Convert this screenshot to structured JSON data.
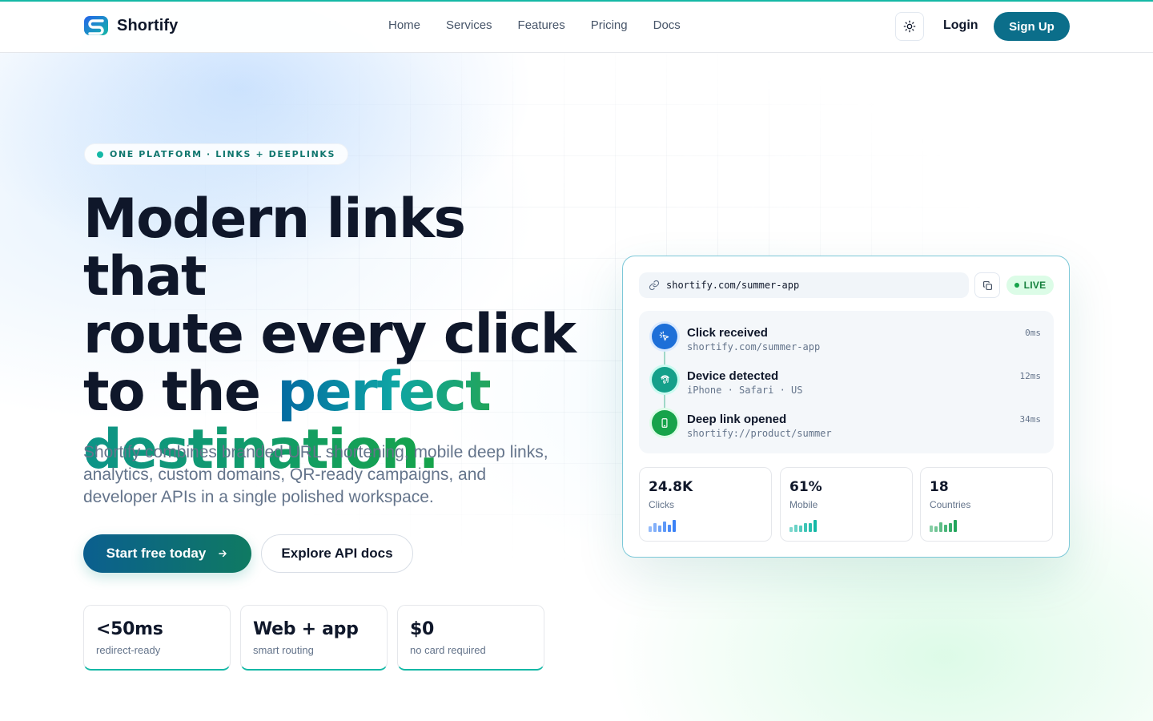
{
  "brand": {
    "name": "Shortify"
  },
  "nav": {
    "links": [
      "Home",
      "Services",
      "Features",
      "Pricing",
      "Docs"
    ],
    "login_label": "Login",
    "signup_label": "Sign Up",
    "theme_icon": "sun-icon"
  },
  "hero": {
    "badge": "ONE PLATFORM · LINKS + DEEPLINKS",
    "title_line1": "Modern links that",
    "title_line2": "route every click",
    "title_line3_plain": "to the ",
    "title_line3_accent": "perfect",
    "title_line4_accent": "destination.",
    "subtitle": "Shortify combines branded URL shortening, mobile deep links, analytics, custom domains, QR-ready campaigns, and developer APIs in a single polished workspace.",
    "cta_primary": "Start free today",
    "cta_secondary": "Explore API docs"
  },
  "stats": [
    {
      "value": "<50ms",
      "label": "redirect-ready"
    },
    {
      "value": "Web + app",
      "label": "smart routing"
    },
    {
      "value": "$0",
      "label": "no card required"
    }
  ],
  "card": {
    "url": "shortify.com/summer-app",
    "live_label": "LIVE",
    "events": [
      {
        "title": "Click received",
        "detail": "shortify.com/summer-app",
        "time": "0ms",
        "icon": "cursor-click-icon",
        "color": "#1d6fd8"
      },
      {
        "title": "Device detected",
        "detail": "iPhone · Safari · US",
        "time": "12ms",
        "icon": "fingerprint-icon",
        "color": "#14a08a"
      },
      {
        "title": "Deep link opened",
        "detail": "shortify://product/summer",
        "time": "34ms",
        "icon": "smartphone-icon",
        "color": "#16a34a"
      }
    ],
    "metrics": [
      {
        "value": "24.8K",
        "label": "Clicks",
        "color": "#3b82f6",
        "bars": [
          0.45,
          0.7,
          0.55,
          0.85,
          0.6,
          1.0
        ]
      },
      {
        "value": "61%",
        "label": "Mobile",
        "color": "#14b8a6",
        "bars": [
          0.4,
          0.6,
          0.5,
          0.75,
          0.7,
          1.0
        ]
      },
      {
        "value": "18",
        "label": "Countries",
        "color": "#22a55b",
        "bars": [
          0.55,
          0.45,
          0.8,
          0.6,
          0.75,
          1.0
        ]
      }
    ]
  },
  "colors": {
    "accent": "#0b6e8a",
    "teal": "#14b8a6",
    "green": "#16a34a"
  }
}
